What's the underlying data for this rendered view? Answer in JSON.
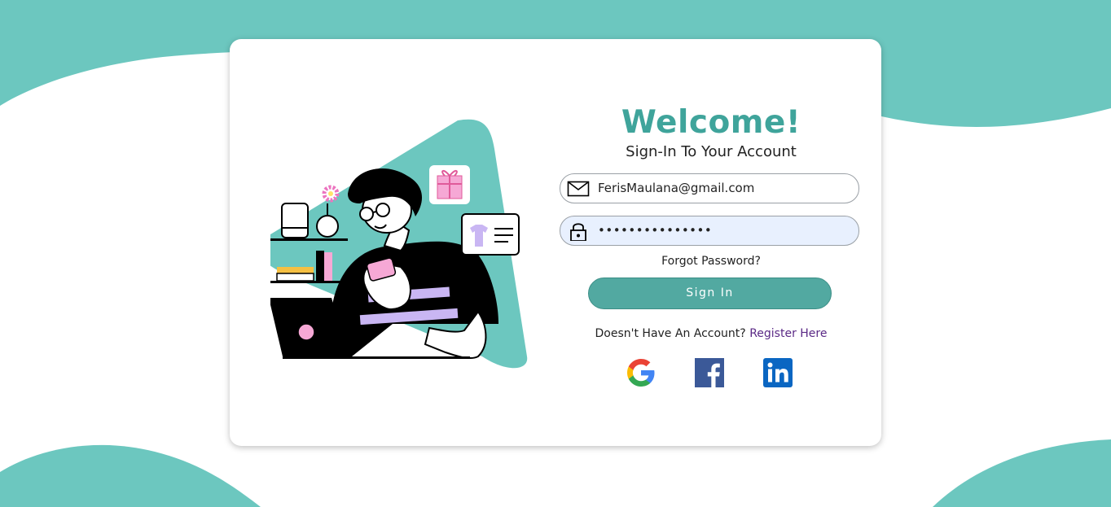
{
  "login": {
    "title": "Welcome!",
    "subtitle": "Sign-In To Your Account",
    "email_value": "FerisMaulana@gmail.com",
    "password_value": "•••••••••••••••",
    "forgot_label": "Forgot Password?",
    "signin_label": "Sign In",
    "register_prompt": "Doesn't Have An Account?",
    "register_link": "Register Here"
  },
  "icons": {
    "email": "envelope-icon",
    "password": "padlock-icon",
    "google": "google-icon",
    "facebook": "facebook-icon",
    "linkedin": "linkedin-icon"
  },
  "colors": {
    "accent": "#6cc7bf",
    "title": "#3fa49b",
    "button": "#52a9a1",
    "link": "#5b2a86",
    "password_fill": "#e8f0fe"
  }
}
